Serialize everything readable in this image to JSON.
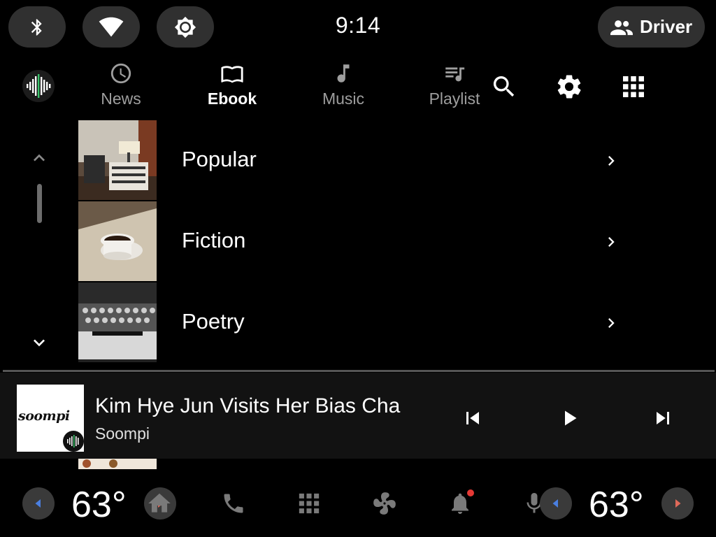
{
  "status_bar": {
    "time": "9:14",
    "quick_toggles": [
      "bluetooth-icon",
      "wifi-icon",
      "brightness-icon"
    ],
    "profile_label": "Driver"
  },
  "app_bar": {
    "tabs": [
      {
        "label": "News",
        "icon": "clock-icon",
        "active": false
      },
      {
        "label": "Ebook",
        "icon": "book-icon",
        "active": true
      },
      {
        "label": "Music",
        "icon": "music-note-icon",
        "active": false
      },
      {
        "label": "Playlist",
        "icon": "playlist-icon",
        "active": false
      }
    ],
    "tools": [
      "search-icon",
      "gear-icon",
      "app-grid-icon"
    ]
  },
  "list": {
    "items": [
      {
        "label": "Popular"
      },
      {
        "label": "Fiction"
      },
      {
        "label": "Poetry"
      }
    ]
  },
  "now_playing": {
    "title": "Kim Hye Jun Visits Her Bias Cha",
    "artist": "Soompi",
    "art_text": "soompi"
  },
  "climate": {
    "left_temp": "63°",
    "right_temp": "63°"
  },
  "colors": {
    "background": "#000000",
    "pill": "#303030",
    "player_bg": "#121212",
    "inactive": "#9e9e9e",
    "notification": "#e53935",
    "temp_down": "#4a7fe0",
    "temp_up": "#e06a5a"
  }
}
